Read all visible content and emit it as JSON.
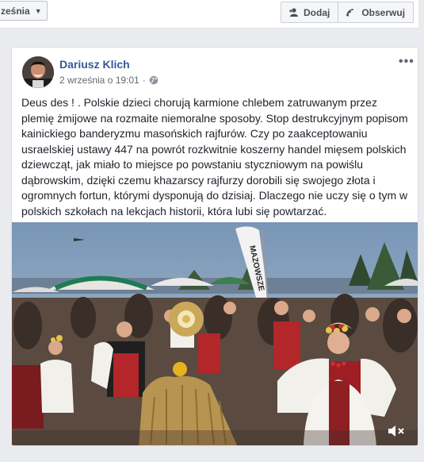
{
  "header": {
    "month_dropdown_label": "ześnia",
    "add_friend_label": "Dodaj",
    "follow_label": "Obserwuj"
  },
  "post": {
    "author": "Dariusz Klich",
    "timestamp": "2 września o 19:01",
    "privacy_icon": "globe-icon",
    "more_icon": "more-options-icon",
    "text": "Deus des ! . Polskie dzieci chorują karmione chlebem zatruwanym przez plemię żmijowe na rozmaite niemoralne sposoby. Stop destrukcyjnym popisom kainickiego banderyzmu masońskich rajfurów. Czy po zaakceptowaniu usraelskiej ustawy 447 na powrót rozkwitnie koszerny handel mięsem polskich dziewcząt, jak miało to miejsce po powstaniu styczniowym na powiślu dąbrowskim, dzięki czemu khazarscy rajfurzy dorobili się swojego złota i ogromnych fortun, którymi dysponują do dzisiaj. Dlaczego nie uczy się o tym w polskich szkołach na lekcjach historii, która lubi się powtarzać.",
    "video_banner_text": "MAZOWSZE"
  },
  "colors": {
    "link": "#385898",
    "page_bg": "#e9ebee"
  }
}
